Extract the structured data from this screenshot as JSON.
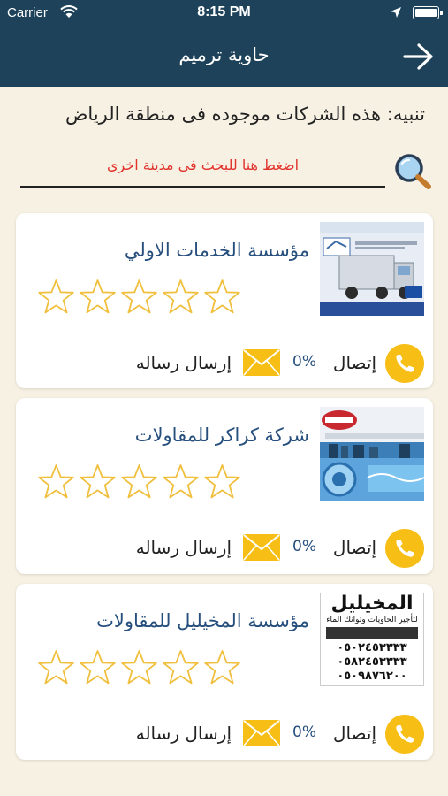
{
  "status_bar": {
    "carrier": "Carrier",
    "time": "8:15 PM"
  },
  "nav": {
    "title": "حاوية ترميم"
  },
  "notice": "تنبيه: هذه الشركات موجوده فى منطقة الرياض",
  "search": {
    "prompt": "اضغط هنا للبحث فى مدينة اخرى"
  },
  "companies": [
    {
      "name": "مؤسسة الخدمات الاولي",
      "rating": 0,
      "percent": "0%",
      "call_label": "إتصال",
      "message_label": "إرسال رساله"
    },
    {
      "name": "شركة كراكر للمقاولات",
      "rating": 0,
      "percent": "0%",
      "call_label": "إتصال",
      "message_label": "إرسال رساله"
    },
    {
      "name": "مؤسسة المخيليل للمقاولات",
      "rating": 0,
      "percent": "0%",
      "call_label": "إتصال",
      "message_label": "إرسال رساله"
    }
  ],
  "thumbnails": {
    "thumb3_title": "المخيليل",
    "thumb3_subtitle": "لتأجير الحاويات وتوانك الماء",
    "thumb3_phones": [
      "٠٥٠٢٤٥٣٣٣٣",
      "٠٥٨٢٤٥٣٣٣٣",
      "٠٥٠٩٨٧٦٢٠٠"
    ]
  },
  "colors": {
    "nav_bg": "#1d4259",
    "page_bg": "#f7f1e3",
    "accent": "#f7bf16",
    "link": "#264f7d",
    "search_prompt": "#e2322d"
  },
  "icons": [
    "wifi-icon",
    "location-arrow-icon",
    "battery-icon",
    "back-arrow-icon",
    "search-icon",
    "star-outline-icon",
    "phone-icon",
    "envelope-icon"
  ]
}
